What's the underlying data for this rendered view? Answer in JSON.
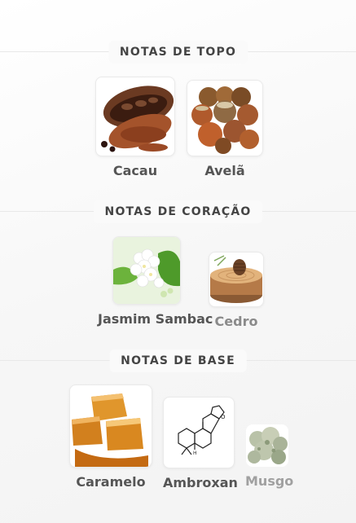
{
  "sections": [
    {
      "title": "NOTAS DE TOPO",
      "notes": [
        {
          "label": "Cacau",
          "icon": "cacao-icon"
        },
        {
          "label": "Avelã",
          "icon": "hazelnut-icon"
        }
      ]
    },
    {
      "title": "NOTAS DE CORAÇÃO",
      "notes": [
        {
          "label": "Jasmim Sambac",
          "icon": "jasmine-icon"
        },
        {
          "label": "Cedro",
          "icon": "cedar-icon"
        }
      ]
    },
    {
      "title": "NOTAS DE BASE",
      "notes": [
        {
          "label": "Caramelo",
          "icon": "caramel-icon"
        },
        {
          "label": "Ambroxan",
          "icon": "ambroxan-molecule-icon"
        },
        {
          "label": "Musgo",
          "icon": "moss-icon"
        }
      ]
    }
  ]
}
